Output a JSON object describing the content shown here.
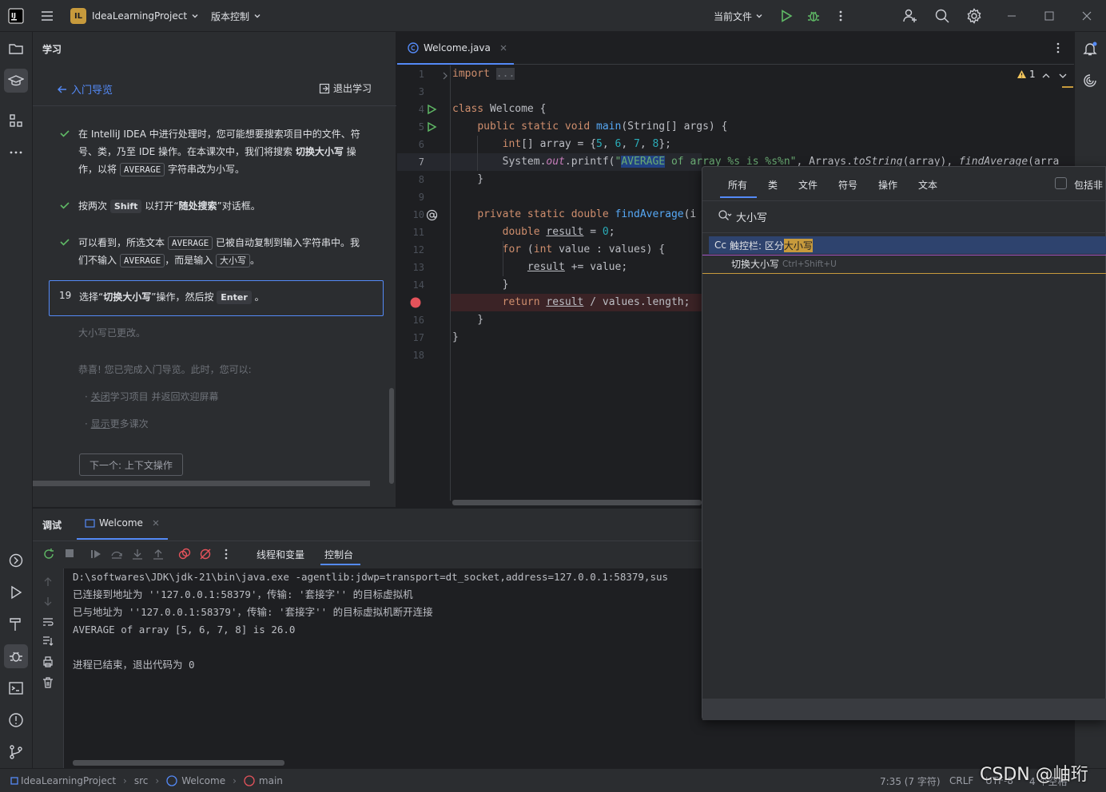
{
  "titlebar": {
    "project_badge": "IL",
    "project_name": "IdeaLearningProject",
    "vcs": "版本控制",
    "run_config": "当前文件"
  },
  "learn_panel": {
    "title": "学习",
    "back_link": "入门导览",
    "exit": "退出学习",
    "step1_a": "在 IntelliJ IDEA 中进行处理时，您可能想要搜索项目中的文件、符",
    "step1_b": "号、类，乃至 IDE 操作。在本课次中，我们将搜索",
    "step1_bold": "切换大小写",
    "step1_c": "操",
    "step1_d": "作，以将",
    "step1_code": "AVERAGE",
    "step1_e": "字符串改为小写。",
    "step2_a": "按两次",
    "step2_key": "Shift",
    "step2_b": "以打开“",
    "step2_bold": "随处搜索",
    "step2_c": "”对话框。",
    "step3_a": "可以看到，所选文本",
    "step3_code": "AVERAGE",
    "step3_b": "已被自动复制到输入字符串中。我",
    "step3_c": "们不输入",
    "step3_code2": "AVERAGE",
    "step3_d": "，而是输入",
    "step3_code3": "大小写",
    "step3_e": "。",
    "current_num": "19",
    "current_a": "选择“",
    "current_bold": "切换大小写",
    "current_b": "”操作，然后按",
    "current_key": "Enter",
    "current_c": "。",
    "after1": "大小写已更改。",
    "after2": "恭喜! 您已完成入门导览。此时，您可以:",
    "after3_link": "关闭",
    "after3_rest": "学习项目 并返回欢迎屏幕",
    "after4_link": "显示",
    "after4_rest": "更多课次",
    "next_button": "下一个: 上下文操作"
  },
  "editor": {
    "tab": "Welcome.java",
    "warning_count": "1",
    "line_numbers": [
      "1",
      "3",
      "4",
      "5",
      "6",
      "7",
      "8",
      "9",
      "10",
      "11",
      "12",
      "13",
      "14",
      "",
      "16",
      "17",
      "18"
    ]
  },
  "popup": {
    "tabs": [
      "所有",
      "类",
      "文件",
      "符号",
      "操作",
      "文本"
    ],
    "include": "包括非",
    "search_value": "大小写",
    "result1_prefix": "Cc",
    "result1_text": "触控栏: 区分",
    "result1_hl": "大小写",
    "result2_text": "切换大小写",
    "result2_shortcut": "Ctrl+Shift+U"
  },
  "debug": {
    "title": "调试",
    "tab": "Welcome",
    "subtab1": "线程和变量",
    "subtab2": "控制台",
    "console": [
      "D:\\softwares\\JDK\\jdk-21\\bin\\java.exe -agentlib:jdwp=transport=dt_socket,address=127.0.0.1:58379,sus",
      "已连接到地址为 ''127.0.0.1:58379'，传输: '套接字'' 的目标虚拟机",
      "已与地址为 ''127.0.0.1:58379'，传输: '套接字'' 的目标虚拟机断开连接",
      "AVERAGE of array [5, 6, 7, 8] is 26.0",
      "",
      "进程已结束，退出代码为 0"
    ]
  },
  "statusbar": {
    "crumbs": [
      "IdeaLearningProject",
      "src",
      "Welcome",
      "main"
    ],
    "position": "7:35 (7 字符)",
    "line_sep": "CRLF",
    "encoding": "UTF-8",
    "indent": "4 个空格",
    "watermark": "CSDN @岫珩"
  }
}
